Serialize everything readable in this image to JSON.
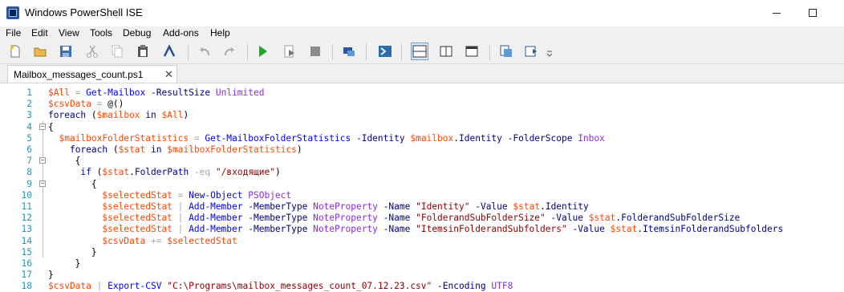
{
  "window": {
    "title": "Windows PowerShell ISE"
  },
  "menu": [
    "File",
    "Edit",
    "View",
    "Tools",
    "Debug",
    "Add-ons",
    "Help"
  ],
  "toolbar": {
    "buttons": [
      "new-icon",
      "open-icon",
      "save-icon",
      "cut-icon",
      "copy-icon",
      "paste-icon",
      "run-remote-icon",
      "undo-icon",
      "redo-icon",
      "run-script-icon",
      "run-selection-icon",
      "stop-icon",
      "new-remote-tab-icon",
      "powershell-icon",
      "script-pane-top-icon",
      "script-pane-right-icon",
      "script-pane-maximized-icon",
      "show-commands-icon",
      "show-addon-icon",
      "overflow-icon"
    ]
  },
  "tab": {
    "label": "Mailbox_messages_count.ps1",
    "close": "✕"
  },
  "editor": {
    "line_numbers": [
      "1",
      "2",
      "3",
      "4",
      "5",
      "6",
      "7",
      "8",
      "9",
      "10",
      "11",
      "12",
      "13",
      "14",
      "15",
      "16",
      "17",
      "18"
    ],
    "lines": [
      [
        [
          "v",
          "$All"
        ],
        [
          "o",
          " = "
        ],
        [
          "c",
          "Get-Mailbox"
        ],
        [
          "x",
          " "
        ],
        [
          "p",
          "-ResultSize"
        ],
        [
          "x",
          " "
        ],
        [
          "t",
          "Unlimited"
        ]
      ],
      [
        [
          "v",
          "$csvData"
        ],
        [
          "o",
          " = "
        ],
        [
          "x",
          "@()"
        ]
      ],
      [
        [
          "k",
          "foreach"
        ],
        [
          "x",
          " ("
        ],
        [
          "v",
          "$mailbox"
        ],
        [
          "x",
          " "
        ],
        [
          "k",
          "in"
        ],
        [
          "x",
          " "
        ],
        [
          "v",
          "$All"
        ],
        [
          "x",
          ")"
        ]
      ],
      [
        [
          "x",
          "{"
        ]
      ],
      [
        [
          "x",
          "  "
        ],
        [
          "v",
          "$mailboxFolderStatistics"
        ],
        [
          "o",
          " = "
        ],
        [
          "c",
          "Get-MailboxFolderStatistics"
        ],
        [
          "x",
          " "
        ],
        [
          "p",
          "-Identity"
        ],
        [
          "x",
          " "
        ],
        [
          "v",
          "$mailbox"
        ],
        [
          "x",
          "."
        ],
        [
          "k",
          "Identity"
        ],
        [
          "x",
          " "
        ],
        [
          "p",
          "-FolderScope"
        ],
        [
          "x",
          " "
        ],
        [
          "t",
          "Inbox"
        ]
      ],
      [
        [
          "x",
          "    "
        ],
        [
          "k",
          "foreach"
        ],
        [
          "x",
          " ("
        ],
        [
          "v",
          "$stat"
        ],
        [
          "x",
          " "
        ],
        [
          "k",
          "in"
        ],
        [
          "x",
          " "
        ],
        [
          "v",
          "$mailboxFolderStatistics"
        ],
        [
          "x",
          ")"
        ]
      ],
      [
        [
          "x",
          "     {"
        ]
      ],
      [
        [
          "x",
          "      "
        ],
        [
          "k",
          "if"
        ],
        [
          "x",
          " ("
        ],
        [
          "v",
          "$stat"
        ],
        [
          "x",
          "."
        ],
        [
          "k",
          "FolderPath"
        ],
        [
          "x",
          " "
        ],
        [
          "o",
          "-eq"
        ],
        [
          "x",
          " "
        ],
        [
          "s",
          "\"/входящие\""
        ],
        [
          "x",
          ")"
        ]
      ],
      [
        [
          "x",
          "        {"
        ]
      ],
      [
        [
          "x",
          "          "
        ],
        [
          "v",
          "$selectedStat"
        ],
        [
          "o",
          " = "
        ],
        [
          "c",
          "New-Object"
        ],
        [
          "x",
          " "
        ],
        [
          "t",
          "PSObject"
        ]
      ],
      [
        [
          "x",
          "          "
        ],
        [
          "v",
          "$selectedStat"
        ],
        [
          "o",
          " | "
        ],
        [
          "c",
          "Add-Member"
        ],
        [
          "x",
          " "
        ],
        [
          "p",
          "-MemberType"
        ],
        [
          "x",
          " "
        ],
        [
          "t",
          "NoteProperty"
        ],
        [
          "x",
          " "
        ],
        [
          "p",
          "-Name"
        ],
        [
          "x",
          " "
        ],
        [
          "s",
          "\"Identity\""
        ],
        [
          "x",
          " "
        ],
        [
          "p",
          "-Value"
        ],
        [
          "x",
          " "
        ],
        [
          "v",
          "$stat"
        ],
        [
          "x",
          "."
        ],
        [
          "k",
          "Identity"
        ]
      ],
      [
        [
          "x",
          "          "
        ],
        [
          "v",
          "$selectedStat"
        ],
        [
          "o",
          " | "
        ],
        [
          "c",
          "Add-Member"
        ],
        [
          "x",
          " "
        ],
        [
          "p",
          "-MemberType"
        ],
        [
          "x",
          " "
        ],
        [
          "t",
          "NoteProperty"
        ],
        [
          "x",
          " "
        ],
        [
          "p",
          "-Name"
        ],
        [
          "x",
          " "
        ],
        [
          "s",
          "\"FolderandSubFolderSize\""
        ],
        [
          "x",
          " "
        ],
        [
          "p",
          "-Value"
        ],
        [
          "x",
          " "
        ],
        [
          "v",
          "$stat"
        ],
        [
          "x",
          "."
        ],
        [
          "k",
          "FolderandSubFolderSize"
        ]
      ],
      [
        [
          "x",
          "          "
        ],
        [
          "v",
          "$selectedStat"
        ],
        [
          "o",
          " | "
        ],
        [
          "c",
          "Add-Member"
        ],
        [
          "x",
          " "
        ],
        [
          "p",
          "-MemberType"
        ],
        [
          "x",
          " "
        ],
        [
          "t",
          "NoteProperty"
        ],
        [
          "x",
          " "
        ],
        [
          "p",
          "-Name"
        ],
        [
          "x",
          " "
        ],
        [
          "s",
          "\"ItemsinFolderandSubfolders\""
        ],
        [
          "x",
          " "
        ],
        [
          "p",
          "-Value"
        ],
        [
          "x",
          " "
        ],
        [
          "v",
          "$stat"
        ],
        [
          "x",
          "."
        ],
        [
          "k",
          "ItemsinFolderandSubfolders"
        ]
      ],
      [
        [
          "x",
          "          "
        ],
        [
          "v",
          "$csvData"
        ],
        [
          "o",
          " += "
        ],
        [
          "v",
          "$selectedStat"
        ]
      ],
      [
        [
          "x",
          "        }"
        ]
      ],
      [
        [
          "x",
          "     }"
        ]
      ],
      [
        [
          "x",
          "}"
        ]
      ],
      [
        [
          "v",
          "$csvData"
        ],
        [
          "o",
          " | "
        ],
        [
          "c",
          "Export-CSV"
        ],
        [
          "x",
          " "
        ],
        [
          "s",
          "\"C:\\Programs\\mailbox_messages_count_07.12.23.csv\""
        ],
        [
          "x",
          " "
        ],
        [
          "p",
          "-Encoding"
        ],
        [
          "x",
          " "
        ],
        [
          "t",
          "UTF8"
        ]
      ]
    ]
  },
  "colors": {
    "variable": "#ff4500",
    "command": "#0000ff",
    "parameter": "#000080",
    "string": "#8b0000",
    "type": "#8a2be2",
    "keyword": "#00008b",
    "line_number": "#2b91af"
  }
}
